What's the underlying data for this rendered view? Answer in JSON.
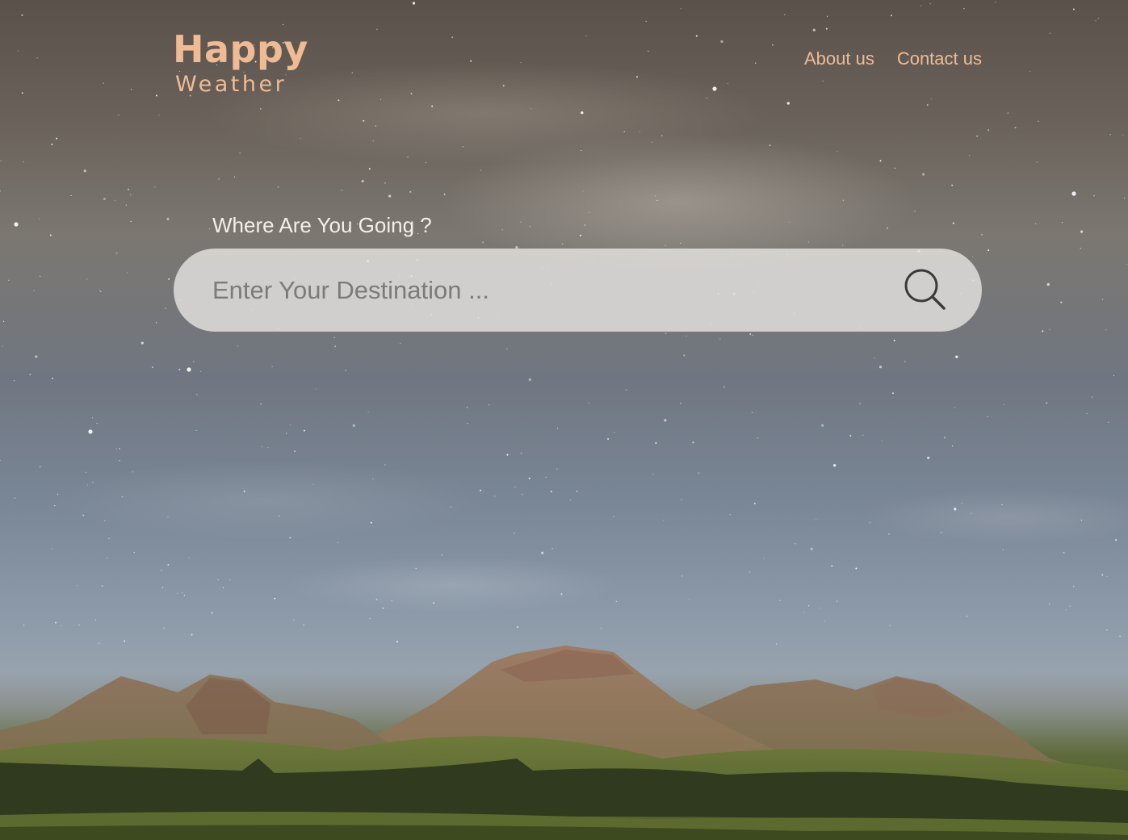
{
  "brand": {
    "name_line1": "Happy",
    "name_line2": "Weather",
    "accent_color": "#efbb94"
  },
  "nav": {
    "items": [
      {
        "label": "About us"
      },
      {
        "label": "Contact us"
      }
    ]
  },
  "search": {
    "label": "Where Are You Going ?",
    "placeholder": "Enter Your Destination ...",
    "value": "",
    "icon": "search-icon"
  }
}
